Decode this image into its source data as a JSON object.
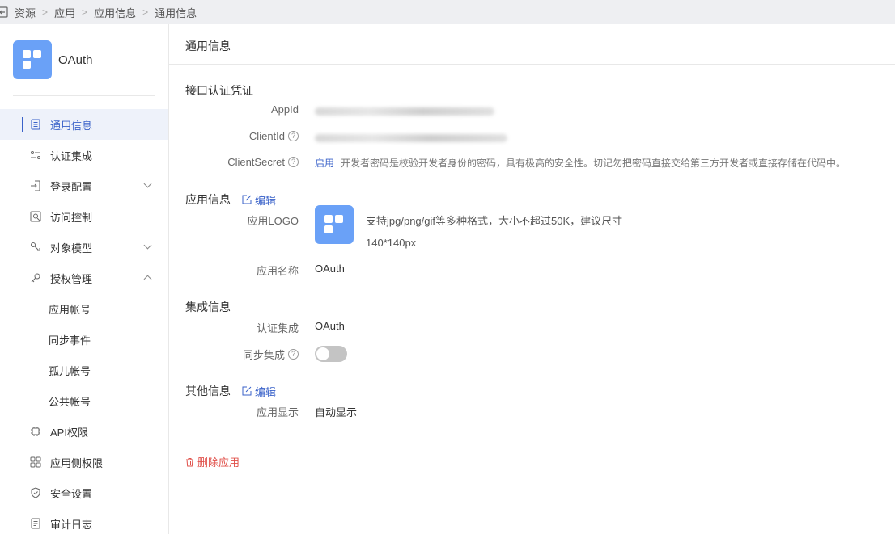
{
  "breadcrumb": [
    "资源",
    "应用",
    "应用信息",
    "通用信息"
  ],
  "app": {
    "name": "OAuth"
  },
  "menu": [
    {
      "label": "通用信息",
      "icon": "document-icon",
      "active": true
    },
    {
      "label": "认证集成",
      "icon": "sliders-icon"
    },
    {
      "label": "登录配置",
      "icon": "login-icon",
      "chevron": "down"
    },
    {
      "label": "访问控制",
      "icon": "access-icon"
    },
    {
      "label": "对象模型",
      "icon": "model-icon",
      "chevron": "down"
    },
    {
      "label": "授权管理",
      "icon": "key-icon",
      "chevron": "up"
    },
    {
      "label": "应用帐号",
      "sub": true
    },
    {
      "label": "同步事件",
      "sub": true
    },
    {
      "label": "孤儿帐号",
      "sub": true
    },
    {
      "label": "公共帐号",
      "sub": true
    },
    {
      "label": "API权限",
      "icon": "chip-icon"
    },
    {
      "label": "应用侧权限",
      "icon": "grid-icon"
    },
    {
      "label": "安全设置",
      "icon": "shield-icon"
    },
    {
      "label": "审计日志",
      "icon": "log-icon"
    }
  ],
  "main": {
    "title": "通用信息",
    "credentials": {
      "title": "接口认证凭证",
      "appid_label": "AppId",
      "clientid_label": "ClientId",
      "secret_label": "ClientSecret",
      "secret_action": "启用",
      "secret_hint": "开发者密码是校验开发者身份的密码，具有极高的安全性。切记勿把密码直接交给第三方开发者或直接存储在代码中。"
    },
    "app_info": {
      "title": "应用信息",
      "edit": "编辑",
      "logo_label": "应用LOGO",
      "logo_hint_1": "支持jpg/png/gif等多种格式，大小不超过50K，建议尺寸",
      "logo_hint_2": "140*140px",
      "name_label": "应用名称",
      "name_value": "OAuth"
    },
    "integration": {
      "title": "集成信息",
      "auth_label": "认证集成",
      "auth_value": "OAuth",
      "sync_label": "同步集成",
      "sync_enabled": false
    },
    "other": {
      "title": "其他信息",
      "edit": "编辑",
      "display_label": "应用显示",
      "display_value": "自动显示"
    },
    "delete_label": "删除应用"
  }
}
